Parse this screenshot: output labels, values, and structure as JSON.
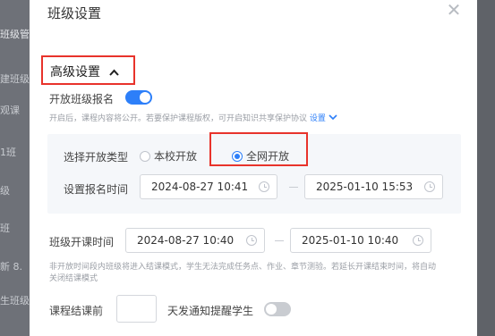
{
  "background": {
    "sidebar_items": [
      "班级管理",
      "建班级",
      "观课",
      "1班",
      "级",
      "班",
      "新 8.",
      "生班级 ("
    ]
  },
  "modal": {
    "title": "班级设置",
    "close_symbol": "✕",
    "advanced": {
      "title": "高级设置",
      "chevron": "chevron-up-icon",
      "open_enroll_label": "开放班级报名",
      "open_enroll_on": true,
      "hint_text": "开启后，课程内容将公开。若要保护课程版权，可开启知识共享保护协议",
      "hint_link": "设置",
      "enroll_type_label": "选择开放类型",
      "enroll_options": [
        {
          "label": "本校开放",
          "checked": false
        },
        {
          "label": "全网开放",
          "checked": true
        }
      ],
      "enroll_time_label": "设置报名时间",
      "enroll_start": "2024-08-27 10:41",
      "enroll_end": "2025-01-10 15:53",
      "class_time_label": "班级开课时间",
      "class_start": "2024-08-27 10:40",
      "class_end": "2025-01-10 10:40",
      "class_hint_line1": "非开放时间段内班级将进入结课模式，学生无法完成任务点、作业、章节测验。若延长开课结束时间，将自动",
      "class_hint_line2": "关闭结课模式",
      "remind_label_before": "课程结课前",
      "remind_days_value": "",
      "remind_label_after": "天发通知提醒学生",
      "remind_on": false
    }
  },
  "colors": {
    "accent": "#2d7ff9",
    "highlight": "#e8332b"
  }
}
